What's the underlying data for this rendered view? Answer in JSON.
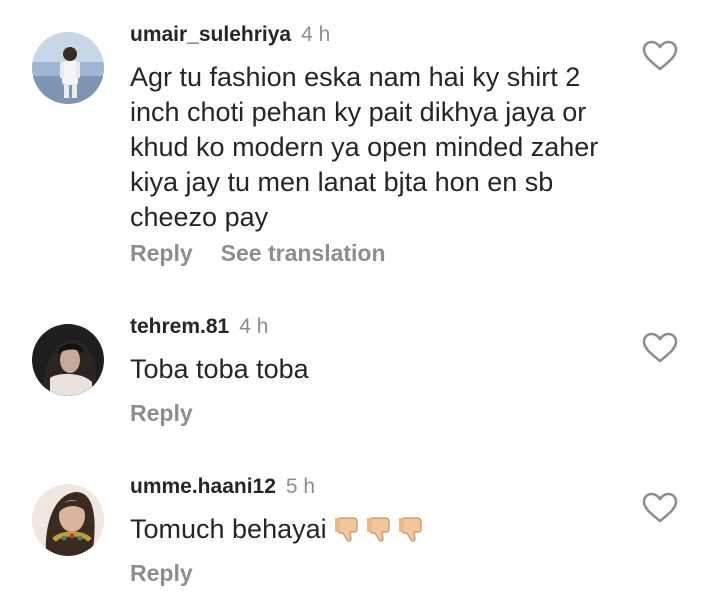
{
  "comments": [
    {
      "username": "umair_sulehriya",
      "time": "4 h",
      "text": "Agr tu fashion eska nam hai ky shirt 2 inch choti pehan ky pait dikhya jaya or khud ko modern ya open minded zaher kiya jay tu men lanat bjta hon en sb cheezo pay",
      "reply_label": "Reply",
      "translation_label": "See translation",
      "avatar_icon": "man-standing-avatar"
    },
    {
      "username": "tehrem.81",
      "time": "4 h",
      "text": "Toba toba toba",
      "reply_label": "Reply",
      "avatar_icon": "woman-dark-avatar"
    },
    {
      "username": "umme.haani12",
      "time": "5 h",
      "text": "Tomuch behayai",
      "emoji": "thumbs-down x3",
      "reply_label": "Reply",
      "avatar_icon": "woman-necklace-avatar"
    }
  ],
  "colors": {
    "primary_text": "#262626",
    "secondary_text": "#8e8e8e",
    "background": "#ffffff"
  },
  "icons": {
    "like": "heart-outline-icon",
    "thumbs_down": "thumbs-down-emoji"
  }
}
